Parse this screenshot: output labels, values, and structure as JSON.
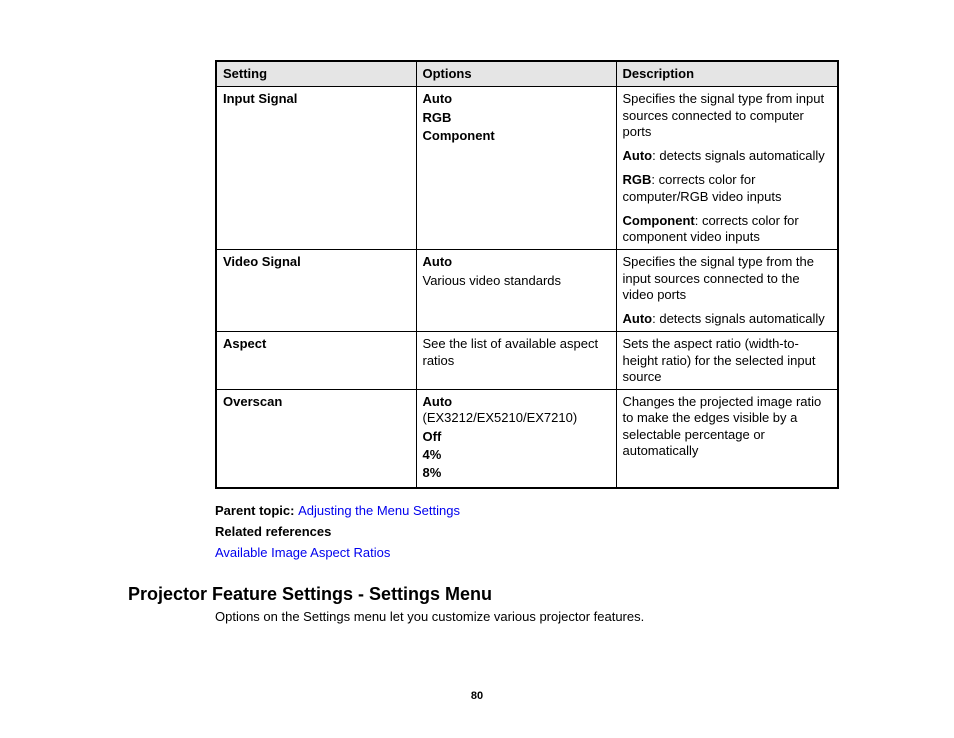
{
  "table": {
    "headers": {
      "setting": "Setting",
      "options": "Options",
      "description": "Description"
    },
    "rows": {
      "input_signal": {
        "setting": "Input Signal",
        "opt1": "Auto",
        "opt2": "RGB",
        "opt3": "Component",
        "desc_intro": "Specifies the signal type from input sources connected to computer ports",
        "desc_auto_label": "Auto",
        "desc_auto_text": ": detects signals automatically",
        "desc_rgb_label": "RGB",
        "desc_rgb_text": ": corrects color for computer/RGB video inputs",
        "desc_comp_label": "Component",
        "desc_comp_text": ": corrects color for component video inputs"
      },
      "video_signal": {
        "setting": "Video Signal",
        "opt1": "Auto",
        "opt2": "Various video standards",
        "desc_intro": "Specifies the signal type from the input sources connected to the video ports",
        "desc_auto_label": "Auto",
        "desc_auto_text": ": detects signals automatically"
      },
      "aspect": {
        "setting": "Aspect",
        "opt": "See the list of available aspect ratios",
        "desc": "Sets the aspect ratio (width-to-height ratio) for the selected input source"
      },
      "overscan": {
        "setting": "Overscan",
        "opt1_label": "Auto",
        "opt1_note": " (EX3212/EX5210/EX7210)",
        "opt2": "Off",
        "opt3": "4%",
        "opt4": "8%",
        "desc": "Changes the projected image ratio to make the edges visible by a selectable percentage or automatically"
      }
    }
  },
  "parent_topic": {
    "label": "Parent topic: ",
    "link": "Adjusting the Menu Settings"
  },
  "related_refs": {
    "label": "Related references",
    "link": "Available Image Aspect Ratios"
  },
  "section": {
    "heading": "Projector Feature Settings - Settings Menu",
    "desc": "Options on the Settings menu let you customize various projector features."
  },
  "page_number": "80"
}
